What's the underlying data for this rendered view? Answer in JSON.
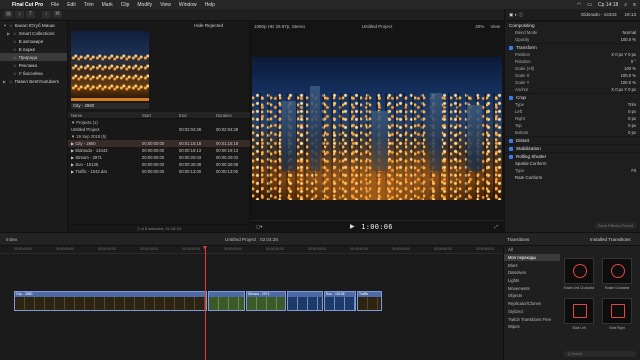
{
  "menubar": {
    "apple": "",
    "app": "Final Cut Pro",
    "items": [
      "File",
      "Edit",
      "Trim",
      "Mark",
      "Clip",
      "Modify",
      "View",
      "Window",
      "Help"
    ],
    "clock": "Cp 14:18"
  },
  "libraries": [
    {
      "label": "Канал Ютуб Миши",
      "indent": 0,
      "tri": "▼",
      "selected": false
    },
    {
      "label": "Smart Collections",
      "indent": 1,
      "tri": "▶",
      "selected": false
    },
    {
      "label": "В автомире",
      "indent": 1,
      "tri": "",
      "selected": false
    },
    {
      "label": "В парке",
      "indent": 1,
      "tri": "",
      "selected": false
    },
    {
      "label": "Природа",
      "indent": 1,
      "tri": "",
      "selected": true
    },
    {
      "label": "Реклама",
      "indent": 1,
      "tri": "",
      "selected": false
    },
    {
      "label": "У бассейна",
      "indent": 1,
      "tri": "",
      "selected": false
    },
    {
      "label": "Павел BestYoutubers",
      "indent": 0,
      "tri": "▶",
      "selected": false
    }
  ],
  "browser": {
    "hide_rejected": "Hide Rejected",
    "thumb_label": "City - 2860",
    "columns": [
      "Name",
      "Start",
      "End",
      "Duration"
    ],
    "rows": [
      {
        "name": "▼ Projects  (1)",
        "start": "",
        "end": "",
        "dur": "",
        "type": "grp"
      },
      {
        "name": "    Untitled Project",
        "start": "",
        "end": "00:02:04:28",
        "dur": "00:02:04:28",
        "type": "row"
      },
      {
        "name": "▼ 19 Sep 2018  (5)",
        "start": "",
        "end": "",
        "dur": "",
        "type": "grp"
      },
      {
        "name": "  ▶ City - 2860",
        "start": "00:00:00:00",
        "end": "00:01:15:18",
        "dur": "00:01:15:18",
        "type": "sel"
      },
      {
        "name": "  ▶ Eldorado - 14343",
        "start": "00:00:00:00",
        "end": "00:00:19:13",
        "dur": "00:00:19:13",
        "type": "row"
      },
      {
        "name": "  ▶ Stream - 2971",
        "start": "00:00:00:00",
        "end": "00:00:20:03",
        "dur": "00:00:20:03",
        "type": "row"
      },
      {
        "name": "  ▶ Sun - 15136",
        "start": "00:00:00:00",
        "end": "00:00:30:08",
        "dur": "00:00:30:08",
        "type": "row"
      },
      {
        "name": "  ▶ Traffic - 1042.dat",
        "start": "00:00:00:00",
        "end": "00:00:13:00",
        "dur": "00:00:13:00",
        "type": "row"
      }
    ],
    "footer": "1 of 6 selected, 01:15:24"
  },
  "viewer": {
    "format": "1080p HD 29.97p, Stereo",
    "title": "Untitled Project",
    "zoom": "40%",
    "view": "View",
    "timecode": "1:00:06"
  },
  "inspector": {
    "clip_name": "Eldorado - 14343",
    "clip_time": "19:13",
    "compositing": "Compositing",
    "blend_label": "Blend Mode",
    "blend_value": "Normal",
    "opacity_label": "Opacity",
    "opacity_value": "100.0 %",
    "transform": "Transform",
    "transform_props": [
      {
        "k": "Position",
        "v": "X  0 px    Y  0 px"
      },
      {
        "k": "Rotation",
        "v": "0 °"
      },
      {
        "k": "Scale (All)",
        "v": "100 %"
      },
      {
        "k": "Scale X",
        "v": "100.0 %"
      },
      {
        "k": "Scale Y",
        "v": "100.0 %"
      },
      {
        "k": "Anchor",
        "v": "X  0 px    Y  0 px"
      }
    ],
    "crop": "Crop",
    "crop_props": [
      {
        "k": "Type",
        "v": "Trim"
      },
      {
        "k": "Left",
        "v": "0 px"
      },
      {
        "k": "Right",
        "v": "0 px"
      },
      {
        "k": "Top",
        "v": "0 px"
      },
      {
        "k": "Bottom",
        "v": "0 px"
      }
    ],
    "distort": "Distort",
    "stabilization": "Stabilization",
    "rolling_shutter": "Rolling Shutter",
    "spatial": "Spatial Conform",
    "spatial_type_label": "Type",
    "spatial_type_value": "Fit",
    "rate_conform": "Rate Conform",
    "save_preset": "Save Effects Preset"
  },
  "timeline_bar": {
    "index": "Index",
    "project": "Untitled Project",
    "duration": "02:04:28",
    "transitions_tab": "Transitions",
    "installed": "Installed Transitions"
  },
  "ruler_ticks": [
    "00:00:00:00",
    "00:00:05:00",
    "00:00:10:00",
    "00:00:15:00",
    "00:00:20:00",
    "00:00:25:00",
    "00:00:30:00",
    "00:00:35:00",
    "00:00:40:00",
    "00:00:45:00",
    "00:00:50:00",
    "00:00:55:00"
  ],
  "clips": [
    {
      "label": "City - 2860",
      "w": 193,
      "kind": "city"
    },
    {
      "label": "",
      "w": 37,
      "kind": "green"
    },
    {
      "label": "Stream - 2971",
      "w": 40,
      "kind": "green"
    },
    {
      "label": "",
      "w": 36,
      "kind": "blue"
    },
    {
      "label": "Sun - 15136",
      "w": 32,
      "kind": "blue"
    },
    {
      "label": "Traffic",
      "w": 25,
      "kind": "city"
    }
  ],
  "transition_categories": [
    "All",
    "Mon переходы",
    "Blurs",
    "Dissolves",
    "Lights",
    "Movements",
    "Objects",
    "Replicator/Clones",
    "Stylized",
    "Twitch Transitions Free",
    "Wipes"
  ],
  "transition_selected": 1,
  "transition_tiles": [
    {
      "label": "Rotate Anti Clockwise",
      "shape": "circle"
    },
    {
      "label": "Rotate Clockwise",
      "shape": "circle"
    },
    {
      "label": "Slide Left",
      "shape": "sq"
    },
    {
      "label": "Slide Right",
      "shape": "sq"
    }
  ],
  "search_placeholder": "Q  Search",
  "colors": {
    "accent": "#3a7cf0",
    "playhead": "#e23a3a",
    "clip": "#4d6aa7"
  }
}
